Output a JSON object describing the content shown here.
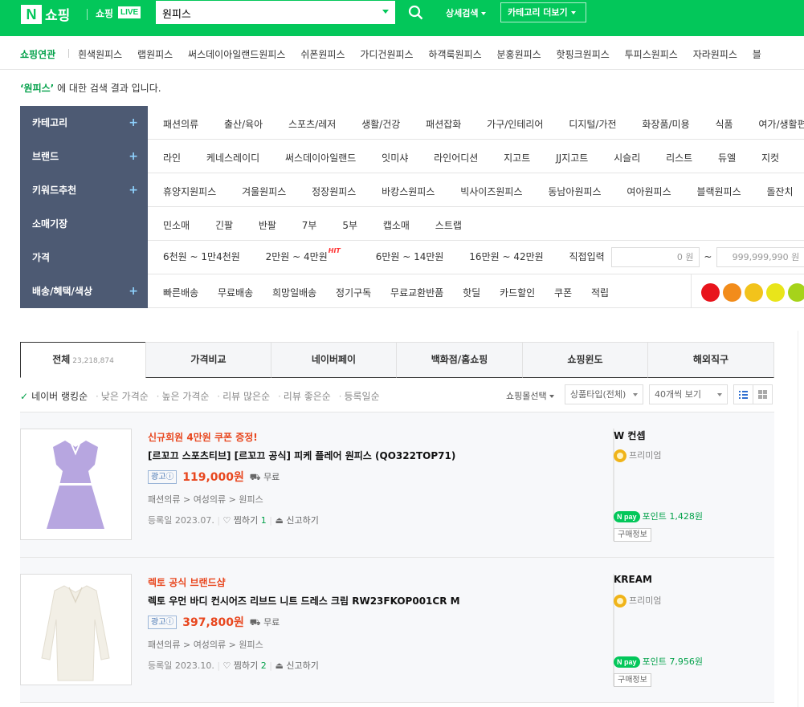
{
  "header": {
    "logo_n": "N",
    "logo_text": "쇼핑",
    "live_text": "쇼핑",
    "live_badge": "LIVE",
    "search_value": "원피스",
    "detail_search": "상세검색",
    "category_more": "카테고리 더보기"
  },
  "related": {
    "title": "쇼핑연관",
    "items": [
      "흰색원피스",
      "랩원피스",
      "써스데이아일랜드원피스",
      "쉬폰원피스",
      "가디건원피스",
      "하객룩원피스",
      "분홍원피스",
      "핫핑크원피스",
      "투피스원피스",
      "자라원피스",
      "블"
    ]
  },
  "result_msg": {
    "query": "‘원피스’",
    "suffix": "에 대한 검색 결과 입니다."
  },
  "filters": [
    {
      "label": "카테고리",
      "plus": "+",
      "values": [
        "패션의류",
        "출산/육아",
        "스포츠/레저",
        "생활/건강",
        "패션잡화",
        "가구/인테리어",
        "디지털/가전",
        "화장품/미용",
        "식품",
        "여가/생활편"
      ]
    },
    {
      "label": "브랜드",
      "plus": "+",
      "values": [
        "라인",
        "케네스레이디",
        "써스데이아일랜드",
        "잇미샤",
        "라인어디션",
        "지고트",
        "JJ지고트",
        "시슬리",
        "리스트",
        "듀엘",
        "지컷"
      ]
    },
    {
      "label": "키워드추천",
      "plus": "+",
      "values": [
        "휴양지원피스",
        "겨울원피스",
        "정장원피스",
        "바캉스원피스",
        "빅사이즈원피스",
        "동남아원피스",
        "여아원피스",
        "블랙원피스",
        "돌잔치"
      ]
    },
    {
      "label": "소매기장",
      "plus": "",
      "values": [
        "민소매",
        "긴팔",
        "반팔",
        "7부",
        "5부",
        "캡소매",
        "스트랩"
      ]
    },
    {
      "label": "가격",
      "plus": "",
      "values": [
        "6천원 ~ 1만4천원",
        "2만원 ~ 4만원",
        "6만원 ~ 14만원",
        "16만원 ~ 42만원",
        "직접입력"
      ]
    },
    {
      "label": "배송/혜택/색상",
      "plus": "+",
      "values": [
        "빠른배송",
        "무료배송",
        "희망일배송",
        "정기구독",
        "무료교환반품",
        "핫딜",
        "카드할인",
        "쿠폰",
        "적립"
      ]
    }
  ],
  "price_filter": {
    "hit": "HIT",
    "min": "0 원",
    "tilde": "~",
    "max": "999,999,990 원"
  },
  "colors": [
    "#e8141c",
    "#f28c1b",
    "#f2c31b",
    "#e9e51a",
    "#a6d31a"
  ],
  "tabs": [
    {
      "label": "전체",
      "count": "23,218,874"
    },
    {
      "label": "가격비교"
    },
    {
      "label": "네이버페이"
    },
    {
      "label": "백화점/홈쇼핑"
    },
    {
      "label": "쇼핑윈도"
    },
    {
      "label": "해외직구"
    }
  ],
  "sort": {
    "active": "네이버 랭킹순",
    "options": [
      "낮은 가격순",
      "높은 가격순",
      "리뷰 많은순",
      "리뷰 좋은순",
      "등록일순"
    ],
    "mall_select": "쇼핑몰선택",
    "type_select": "상품타입(전체)",
    "per_page": "40개씩 보기"
  },
  "products": [
    {
      "promo": "신규회원 4만원 쿠폰 증정!",
      "title": "[르꼬끄 스포츠티브] [르꼬끄 공식] 피케 플레어 원피스 (QO322TOP71)",
      "ad": "광고ⓘ",
      "price": "119,000원",
      "shipping": "무료",
      "category": "패션의류 > 여성의류 > 원피스",
      "registered": "등록일 2023.07.",
      "zzim_label": "찜하기",
      "zzim_count": "1",
      "report": "신고하기",
      "seller": "W 컨셉",
      "grade": "프리미엄",
      "npay_badge": "N pay",
      "point": "포인트 1,428원",
      "buy_info": "구매정보",
      "image_color": "#b7a6e0"
    },
    {
      "promo": "렉토 공식 브랜드샵",
      "title": "렉토 우먼 바디 컨시어즈 리브드 니트 드레스 크림 RW23FKOP001CR M",
      "ad": "광고ⓘ",
      "price": "397,800원",
      "shipping": "무료",
      "category": "패션의류 > 여성의류 > 원피스",
      "registered": "등록일 2023.10.",
      "zzim_label": "찜하기",
      "zzim_count": "2",
      "report": "신고하기",
      "seller": "KREAM",
      "grade": "프리미엄",
      "npay_badge": "N pay",
      "point": "포인트 7,956원",
      "buy_info": "구매정보",
      "image_color": "#f2efe6"
    }
  ]
}
